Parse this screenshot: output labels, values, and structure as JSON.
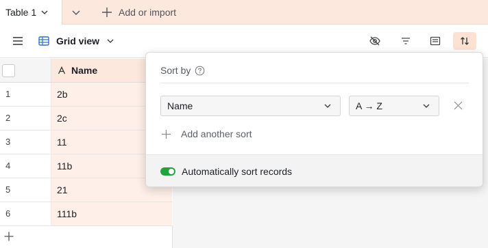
{
  "tabs": {
    "active_label": "Table 1",
    "add_import_label": "Add or import"
  },
  "toolbar": {
    "view_label": "Grid view",
    "icons": [
      "hamburger-icon",
      "grid-view-icon",
      "hide-fields-icon",
      "filter-icon",
      "group-icon",
      "sort-icon"
    ],
    "sort_active": true
  },
  "grid": {
    "column_header": "Name",
    "rows": [
      {
        "num": "1",
        "name": "2b"
      },
      {
        "num": "2",
        "name": "2c"
      },
      {
        "num": "3",
        "name": "11"
      },
      {
        "num": "4",
        "name": "11b"
      },
      {
        "num": "5",
        "name": "21"
      },
      {
        "num": "6",
        "name": "111b"
      }
    ]
  },
  "sort_popover": {
    "title": "Sort by",
    "field_value": "Name",
    "direction_value": "A → Z",
    "add_sort_label": "Add another sort",
    "auto_sort_label": "Automatically sort records",
    "auto_sort_enabled": true
  },
  "colors": {
    "accent_tab_bg": "#fde8dd",
    "toggle_on": "#21a33c",
    "grid_view_icon": "#2d6fd1"
  }
}
